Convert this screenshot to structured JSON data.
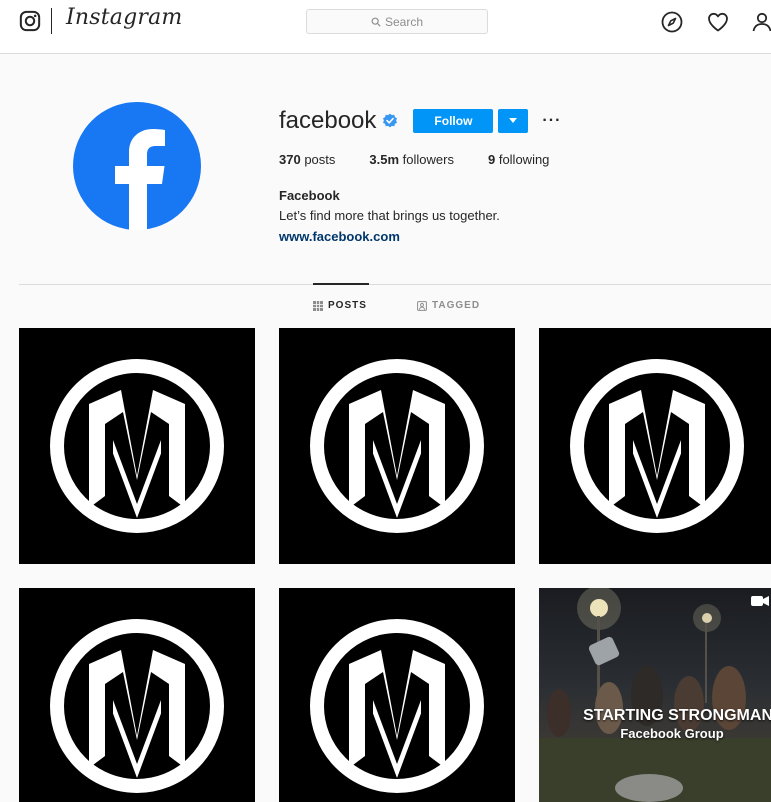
{
  "header": {
    "wordmark": "Instagram",
    "search_placeholder": "Search",
    "icons": [
      "instagram-glyph-icon",
      "search-icon",
      "explore-compass-icon",
      "heart-icon",
      "profile-icon"
    ]
  },
  "profile": {
    "username": "facebook",
    "follow_label": "Follow",
    "more_label": "···",
    "stats": [
      {
        "value": "370",
        "label": "posts"
      },
      {
        "value": "3.5m",
        "label": "followers"
      },
      {
        "value": "9",
        "label": "following"
      }
    ],
    "full_name": "Facebook",
    "bio": "Let’s find more that brings us together.",
    "website": "www.facebook.com"
  },
  "tabs": [
    {
      "label": "POSTS",
      "icon": "grid-icon",
      "active": true
    },
    {
      "label": "TAGGED",
      "icon": "tagged-icon",
      "active": false
    }
  ],
  "posts": [
    {
      "type": "logo"
    },
    {
      "type": "logo"
    },
    {
      "type": "logo"
    },
    {
      "type": "logo"
    },
    {
      "type": "logo"
    },
    {
      "type": "video",
      "caption_line1": "STARTING STRONGMAN",
      "caption_line2": "Facebook Group"
    }
  ],
  "colors": {
    "accent": "#0095f6",
    "facebook_blue": "#1877f2",
    "link": "#00376b",
    "border": "#dbdbdb"
  }
}
